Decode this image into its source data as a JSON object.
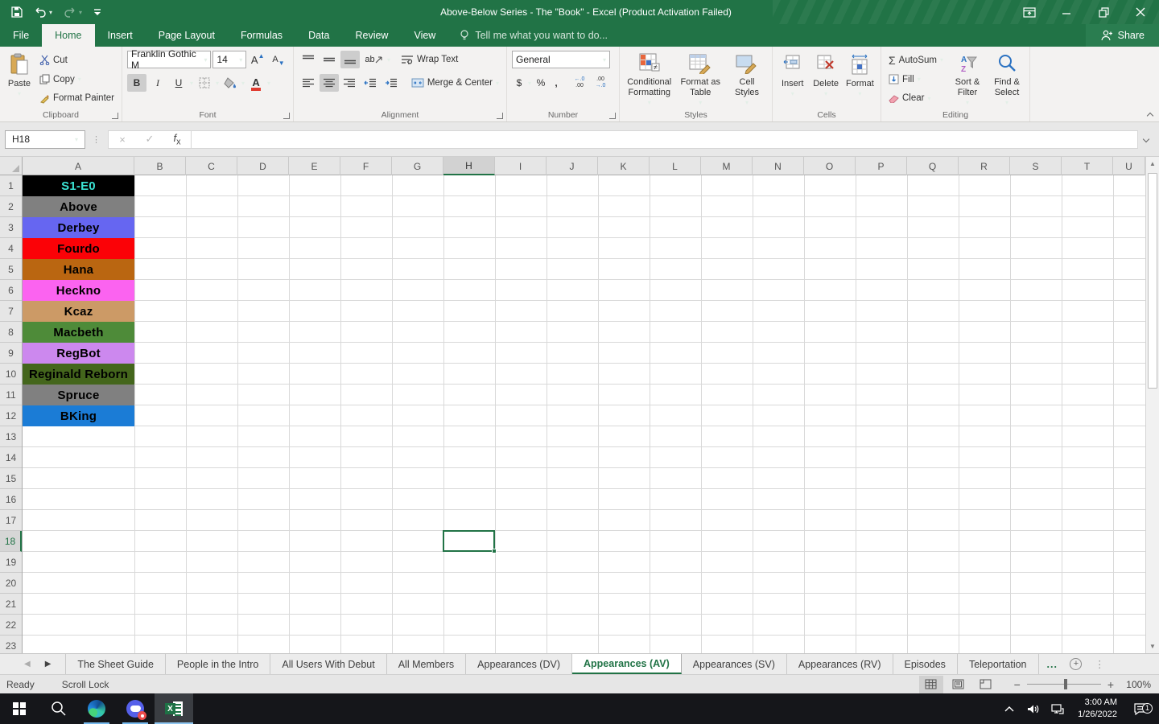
{
  "titlebar": {
    "title": "Above-Below Series - The \"Book\" - Excel (Product Activation Failed)",
    "share_label": "Share"
  },
  "menu": {
    "tabs": [
      "File",
      "Home",
      "Insert",
      "Page Layout",
      "Formulas",
      "Data",
      "Review",
      "View"
    ],
    "active_tab": "Home",
    "tell_me": "Tell me what you want to do..."
  },
  "ribbon": {
    "clipboard": {
      "label": "Clipboard",
      "paste": "Paste",
      "cut": "Cut",
      "copy": "Copy",
      "format_painter": "Format Painter"
    },
    "font": {
      "label": "Font",
      "font_name": "Franklin Gothic M",
      "font_size": "14",
      "bold": "B",
      "italic": "I",
      "underline": "U"
    },
    "alignment": {
      "label": "Alignment",
      "wrap_text": "Wrap Text",
      "merge_center": "Merge & Center",
      "orientation": "ab"
    },
    "number": {
      "label": "Number",
      "format": "General",
      "currency": "$",
      "percent": "%",
      "comma": ","
    },
    "styles": {
      "label": "Styles",
      "conditional": "Conditional Formatting",
      "format_table": "Format as Table",
      "cell_styles": "Cell Styles"
    },
    "cells": {
      "label": "Cells",
      "insert": "Insert",
      "delete": "Delete",
      "format": "Format"
    },
    "editing": {
      "label": "Editing",
      "autosum": "AutoSum",
      "fill": "Fill",
      "clear": "Clear",
      "sort_filter": "Sort & Filter",
      "find_select": "Find & Select"
    }
  },
  "formula_bar": {
    "name_box": "H18",
    "formula": ""
  },
  "grid": {
    "columns": [
      "A",
      "B",
      "C",
      "D",
      "E",
      "F",
      "G",
      "H",
      "I",
      "J",
      "K",
      "L",
      "M",
      "N",
      "O",
      "P",
      "Q",
      "R",
      "S",
      "T",
      "U"
    ],
    "selected_column": "H",
    "selected_row": 18,
    "row_count": 23,
    "cells": [
      {
        "row": 1,
        "label": "S1-E0",
        "bg": "#000000",
        "fg": "#3BE3D4"
      },
      {
        "row": 2,
        "label": "Above",
        "bg": "#808080",
        "fg": "#000000"
      },
      {
        "row": 3,
        "label": "Derbey",
        "bg": "#6666F1",
        "fg": "#000000"
      },
      {
        "row": 4,
        "label": "Fourdo",
        "bg": "#FB0207",
        "fg": "#000000"
      },
      {
        "row": 5,
        "label": "Hana",
        "bg": "#BA6611",
        "fg": "#000000"
      },
      {
        "row": 6,
        "label": "Heckno",
        "bg": "#FB63F0",
        "fg": "#000000"
      },
      {
        "row": 7,
        "label": "Kcaz",
        "bg": "#CC9A66",
        "fg": "#000000"
      },
      {
        "row": 8,
        "label": "Macbeth",
        "bg": "#4E8B39",
        "fg": "#000000"
      },
      {
        "row": 9,
        "label": "RegBot",
        "bg": "#CC88EE",
        "fg": "#000000"
      },
      {
        "row": 10,
        "label": "Reginald Reborn",
        "bg": "#44661C",
        "fg": "#000000"
      },
      {
        "row": 11,
        "label": "Spruce",
        "bg": "#808080",
        "fg": "#000000"
      },
      {
        "row": 12,
        "label": "BKing",
        "bg": "#1B7CD6",
        "fg": "#000000"
      }
    ]
  },
  "sheet_tabs": {
    "tabs": [
      "The Sheet Guide",
      "People in the Intro",
      "All Users With Debut",
      "All Members",
      "Appearances (DV)",
      "Appearances (AV)",
      "Appearances (SV)",
      "Appearances (RV)",
      "Episodes",
      "Teleportation"
    ],
    "active_tab": "Appearances (AV)",
    "overflow_indicator": "..."
  },
  "status_bar": {
    "mode": "Ready",
    "scroll_lock": "Scroll Lock",
    "zoom_level": "100%"
  },
  "taskbar": {
    "time": "3:00 AM",
    "date": "1/26/2022",
    "notification_count": "1"
  },
  "colors": {
    "accent_green": "#217346",
    "selection_green": "#217346",
    "font_color_swatch": "#E03C31"
  }
}
